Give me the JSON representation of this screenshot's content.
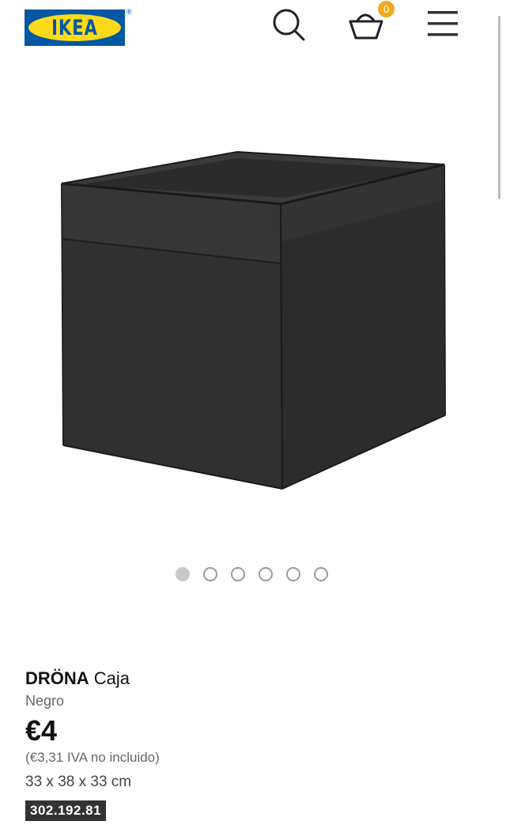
{
  "header": {
    "logo_text": "IKEA",
    "logo_registered": "®",
    "cart_count": "0",
    "icons": [
      "search-icon",
      "basket-icon",
      "hamburger-menu-icon"
    ]
  },
  "gallery": {
    "image_count": 6,
    "active_index": 0
  },
  "product": {
    "name": "DRÖNA",
    "type": "Caja",
    "variant": "Negro",
    "price": "€4",
    "price_excl_vat": "(€3,31 IVA no incluido)",
    "dimensions": "33 x 38 x 33 cm",
    "article_number": "302.192.81"
  },
  "colors": {
    "brand_blue": "#0058a3",
    "brand_yellow": "#ffda1a",
    "badge": "#f2a81d",
    "product_black": "#2a2a2a"
  }
}
